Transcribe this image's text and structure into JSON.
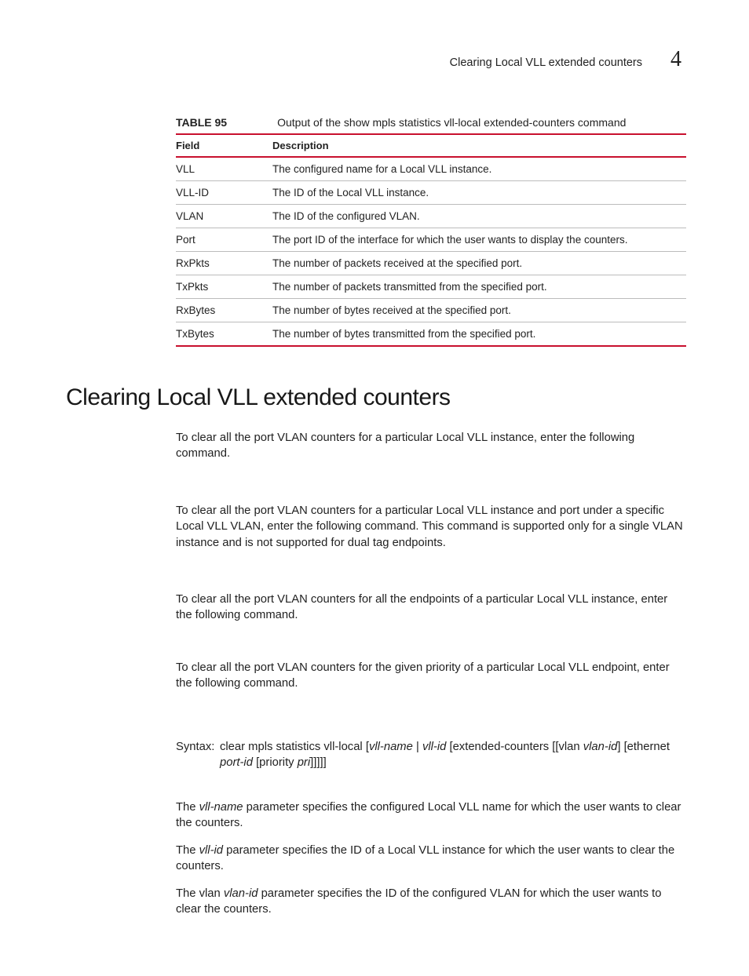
{
  "header": {
    "running_title": "Clearing Local VLL extended counters",
    "chapter_number": "4"
  },
  "table": {
    "label": "TABLE 95",
    "caption": "Output of the show mpls statistics vll-local extended-counters command",
    "head": {
      "c1": "Field",
      "c2": "Description"
    },
    "rows": [
      {
        "c1": "VLL",
        "c2": "The configured name for a Local VLL instance."
      },
      {
        "c1": "VLL-ID",
        "c2": "The ID of the Local VLL instance."
      },
      {
        "c1": "VLAN",
        "c2": "The ID of the configured VLAN."
      },
      {
        "c1": "Port",
        "c2": "The port ID of the interface for which the user wants to display the counters."
      },
      {
        "c1": "RxPkts",
        "c2": "The number of packets received at the specified port."
      },
      {
        "c1": "TxPkts",
        "c2": "The number of packets transmitted from the specified port."
      },
      {
        "c1": "RxBytes",
        "c2": "The number of bytes received at the specified port."
      },
      {
        "c1": "TxBytes",
        "c2": "The number of bytes transmitted from the specified port."
      }
    ]
  },
  "section": {
    "heading": "Clearing Local VLL extended counters",
    "p1": "To clear all the port VLAN counters for a particular Local VLL instance, enter the following command.",
    "p2": "To clear all the port VLAN counters for a particular Local VLL instance and port under a specific Local VLL VLAN, enter the following command. This command is supported only for a single VLAN instance and is not supported for dual tag endpoints.",
    "p3": "To clear all the port VLAN counters for all the endpoints of a particular Local VLL instance, enter the following command.",
    "p4": "To clear all the port VLAN counters for the given priority of a particular Local VLL endpoint, enter the following command.",
    "syntax": {
      "label": "Syntax:",
      "t1": "clear mpls statistics vll-local [",
      "v1": "vll-name",
      "t2": " | ",
      "v2": "vll-id",
      "t3": " [extended-counters [[vlan ",
      "v3": "vlan-id",
      "t4": "] [ethernet ",
      "v4": "port-id",
      "t5": " [priority ",
      "v5": "pri",
      "t6": "]]]]]"
    },
    "p5a": "The ",
    "p5v": "vll-name",
    "p5b": " parameter specifies the configured Local VLL name for which the user wants to clear the counters.",
    "p6a": "The ",
    "p6v": "vll-id",
    "p6b": " parameter specifies the ID of a Local VLL instance for which the user wants to clear the counters.",
    "p7a": "The vlan ",
    "p7v": "vlan-id",
    "p7b": " parameter specifies the ID of the configured VLAN for which the user wants to clear the counters."
  }
}
